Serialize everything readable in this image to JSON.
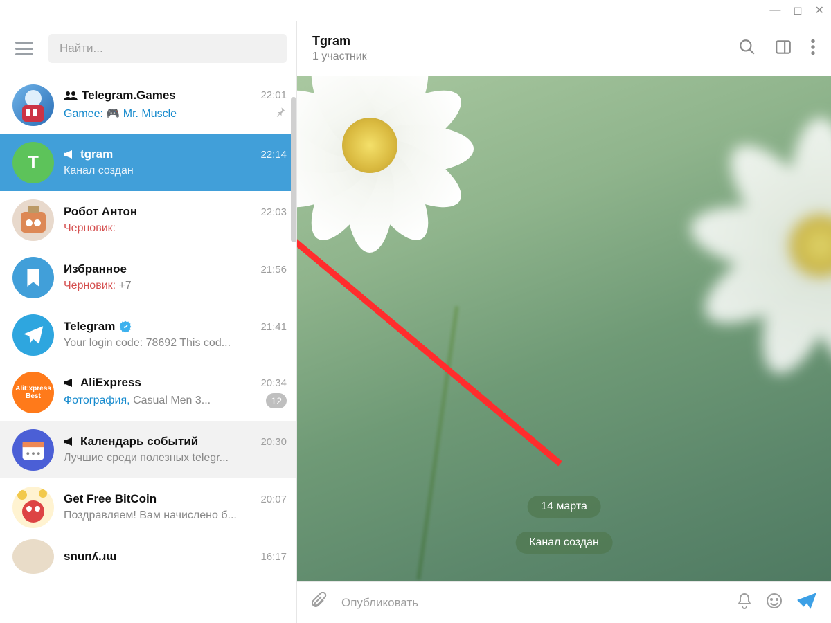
{
  "window_controls": {
    "minimize": "—",
    "maximize": "◻",
    "close": "✕"
  },
  "search": {
    "placeholder": "Найти..."
  },
  "chats": [
    {
      "id": "telegram-games",
      "name": "Telegram.Games",
      "time": "22:01",
      "snippet_prefix": "Gamee:",
      "snippet_link": "Mr. Muscle",
      "type": "group",
      "pinned": true
    },
    {
      "id": "tgram",
      "name": "tgram",
      "time": "22:14",
      "snippet": "Канал создан",
      "type": "channel",
      "selected": true,
      "avatar_letter": "T",
      "avatar_bg": "#5dc35a"
    },
    {
      "id": "robot-anton",
      "name": "Робот Антон",
      "time": "22:03",
      "draft_label": "Черновик:",
      "draft_text": ""
    },
    {
      "id": "saved",
      "name": "Избранное",
      "time": "21:56",
      "draft_label": "Черновик:",
      "draft_text": "+7",
      "avatar_bg": "#419fd9"
    },
    {
      "id": "telegram",
      "name": "Telegram",
      "time": "21:41",
      "snippet": "Your login code: 78692  This cod...",
      "verified": true,
      "avatar_bg": "#2ea6df"
    },
    {
      "id": "aliexpress",
      "name": "AliExpress",
      "time": "20:34",
      "snippet_link": "Фотография,",
      "snippet": "Casual Men 3...",
      "type": "channel",
      "badge": "12",
      "avatar_bg": "#ff7a1a",
      "avatar_text": "AliExpress\nBest"
    },
    {
      "id": "calendar",
      "name": "Календарь событий",
      "time": "20:30",
      "snippet": "Лучшие среди полезных telegr...",
      "type": "channel",
      "avatar_bg": "#4b5fd6"
    },
    {
      "id": "bitcoin",
      "name": "Get Free BitCoin",
      "time": "20:07",
      "snippet": "Поздравляем! Вам начислено б..."
    },
    {
      "id": "snun",
      "name": "snunʎ.ɹɯ",
      "time": "16:17",
      "snippet": ""
    }
  ],
  "conversation": {
    "title": "Tgram",
    "subtitle": "1 участник",
    "date_chip": "14 марта",
    "service_message": "Канал создан",
    "compose_placeholder": "Опубликовать"
  },
  "annotation_arrow": {
    "description": "red arrow pointing from chat area to tgram chat in list"
  }
}
